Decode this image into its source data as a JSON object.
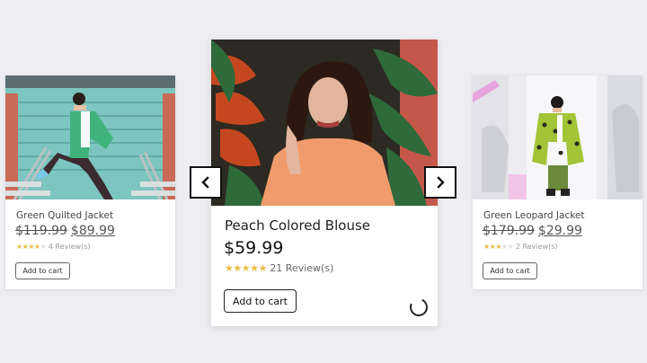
{
  "products": {
    "left": {
      "title": "Green Quilted Jacket",
      "old_price": "$119.99",
      "new_price": "$89.99",
      "stars_filled": "★★★★",
      "stars_empty": "★",
      "rating": 4,
      "reviews": "4 Review(s)",
      "cart_label": "Add to cart"
    },
    "center": {
      "title": "Peach Colored Blouse",
      "price": "$59.99",
      "stars_filled": "★★★★★",
      "rating": 5,
      "reviews": "21 Review(s)",
      "cart_label": "Add to cart"
    },
    "right": {
      "title": "Green Leopard Jacket",
      "old_price": "$179.99",
      "new_price": "$29.99",
      "stars_filled": "★★★",
      "stars_empty": "★★",
      "rating": 3,
      "reviews": "2 Review(s)",
      "cart_label": "Add to cart"
    }
  },
  "carousel": {
    "prev_icon": "chevron-left-icon",
    "next_icon": "chevron-right-icon",
    "loading_icon": "loading-spinner-icon"
  },
  "colors": {
    "background": "#eeeef2",
    "star": "#e9be43",
    "border_dark": "#111111"
  }
}
